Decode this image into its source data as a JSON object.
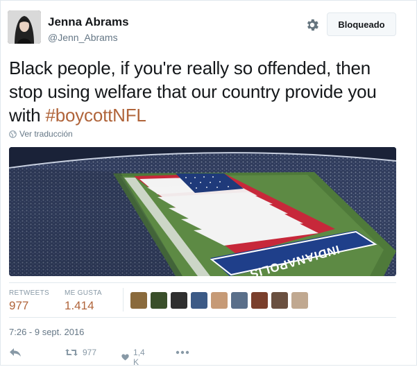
{
  "user": {
    "name": "Jenna Abrams",
    "handle": "@Jenn_Abrams"
  },
  "header": {
    "blocked_label": "Bloqueado"
  },
  "tweet": {
    "text": "Black people, if you're really so offended, then stop using welfare that our country provide you with ",
    "hashtag": "#boycottNFL",
    "translate_label": "Ver traducción"
  },
  "media": {
    "banner_text": "INDIANAPOLIS"
  },
  "stats": {
    "retweets_label": "RETWEETS",
    "retweets_value": "977",
    "likes_label": "ME GUSTA",
    "likes_value": "1.414"
  },
  "likers": [
    "#8a6a3c",
    "#3a4f2a",
    "#2f2f2f",
    "#3c5a86",
    "#c69a76",
    "#5a6f8a",
    "#7a3f2c",
    "#6a5040",
    "#c0a890"
  ],
  "timestamp": "7:26 - 9 sept. 2016",
  "actions": {
    "reply_icon": "reply-icon",
    "retweet_count": "977",
    "like_count": "1,4 K",
    "more_icon": "more-icon"
  },
  "colors": {
    "accent": "#b0643a",
    "muted": "#657786",
    "border": "#e1e8ed"
  }
}
